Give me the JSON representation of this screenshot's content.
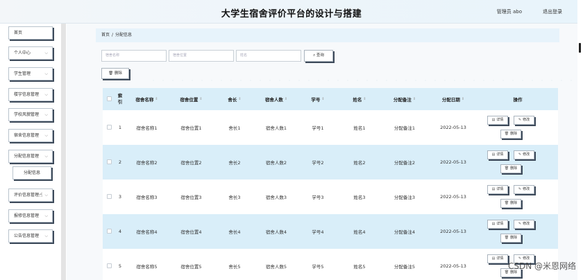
{
  "header": {
    "title": "大学生宿舍评价平台的设计与搭建",
    "user": "管理员 abo",
    "logout": "退出登录"
  },
  "sidebar": {
    "items": [
      {
        "label": "首页",
        "chevron": false
      },
      {
        "label": "个人中心",
        "chevron": true
      },
      {
        "label": "学生管理",
        "chevron": true
      },
      {
        "label": "楼宇信息管理",
        "chevron": true
      },
      {
        "label": "学校风貌管理",
        "chevron": true
      },
      {
        "label": "宿舍信息管理",
        "chevron": true
      },
      {
        "label": "分配信息管理",
        "chevron": true
      },
      {
        "label": "分配信息",
        "chevron": false,
        "sub": true
      },
      {
        "label": "评价信息管理",
        "chevron": true
      },
      {
        "label": "报修信息管理",
        "chevron": true
      },
      {
        "label": "公告信息管理",
        "chevron": true
      }
    ]
  },
  "breadcrumb": {
    "home": "首页",
    "sep": "/",
    "current": "分配信息"
  },
  "search": {
    "fields": [
      "宿舍名称",
      "宿舍位置",
      "姓名"
    ],
    "button": "查询",
    "button_icon": "search-icon"
  },
  "toolbar": {
    "delete": "删除",
    "delete_icon": "trash-icon"
  },
  "table": {
    "headers": [
      "索引",
      "宿舍名称",
      "宿舍位置",
      "舍长",
      "宿舍人数",
      "学号",
      "姓名",
      "分配备注",
      "分配日期",
      "操作"
    ],
    "sortable": [
      false,
      true,
      true,
      true,
      true,
      true,
      true,
      true,
      true,
      false
    ],
    "sort_glyph": "⇕",
    "rows": [
      [
        "1",
        "宿舍名称1",
        "宿舍位置1",
        "舍长1",
        "宿舍人数1",
        "学号1",
        "姓名1",
        "分配备注1",
        "2022-05-13"
      ],
      [
        "2",
        "宿舍名称2",
        "宿舍位置2",
        "舍长2",
        "宿舍人数2",
        "学号2",
        "姓名2",
        "分配备注2",
        "2022-05-13"
      ],
      [
        "3",
        "宿舍名称3",
        "宿舍位置3",
        "舍长3",
        "宿舍人数3",
        "学号3",
        "姓名3",
        "分配备注3",
        "2022-05-13"
      ],
      [
        "4",
        "宿舍名称4",
        "宿舍位置4",
        "舍长4",
        "宿舍人数4",
        "学号4",
        "姓名4",
        "分配备注4",
        "2022-05-13"
      ],
      [
        "5",
        "宿舍名称5",
        "宿舍位置5",
        "舍长5",
        "宿舍人数5",
        "学号5",
        "姓名5",
        "分配备注5",
        "2022-05-13"
      ]
    ],
    "actions": {
      "detail": "详情",
      "edit": "修改",
      "delete": "删除"
    }
  },
  "watermark": "CSDN @米恩网络"
}
